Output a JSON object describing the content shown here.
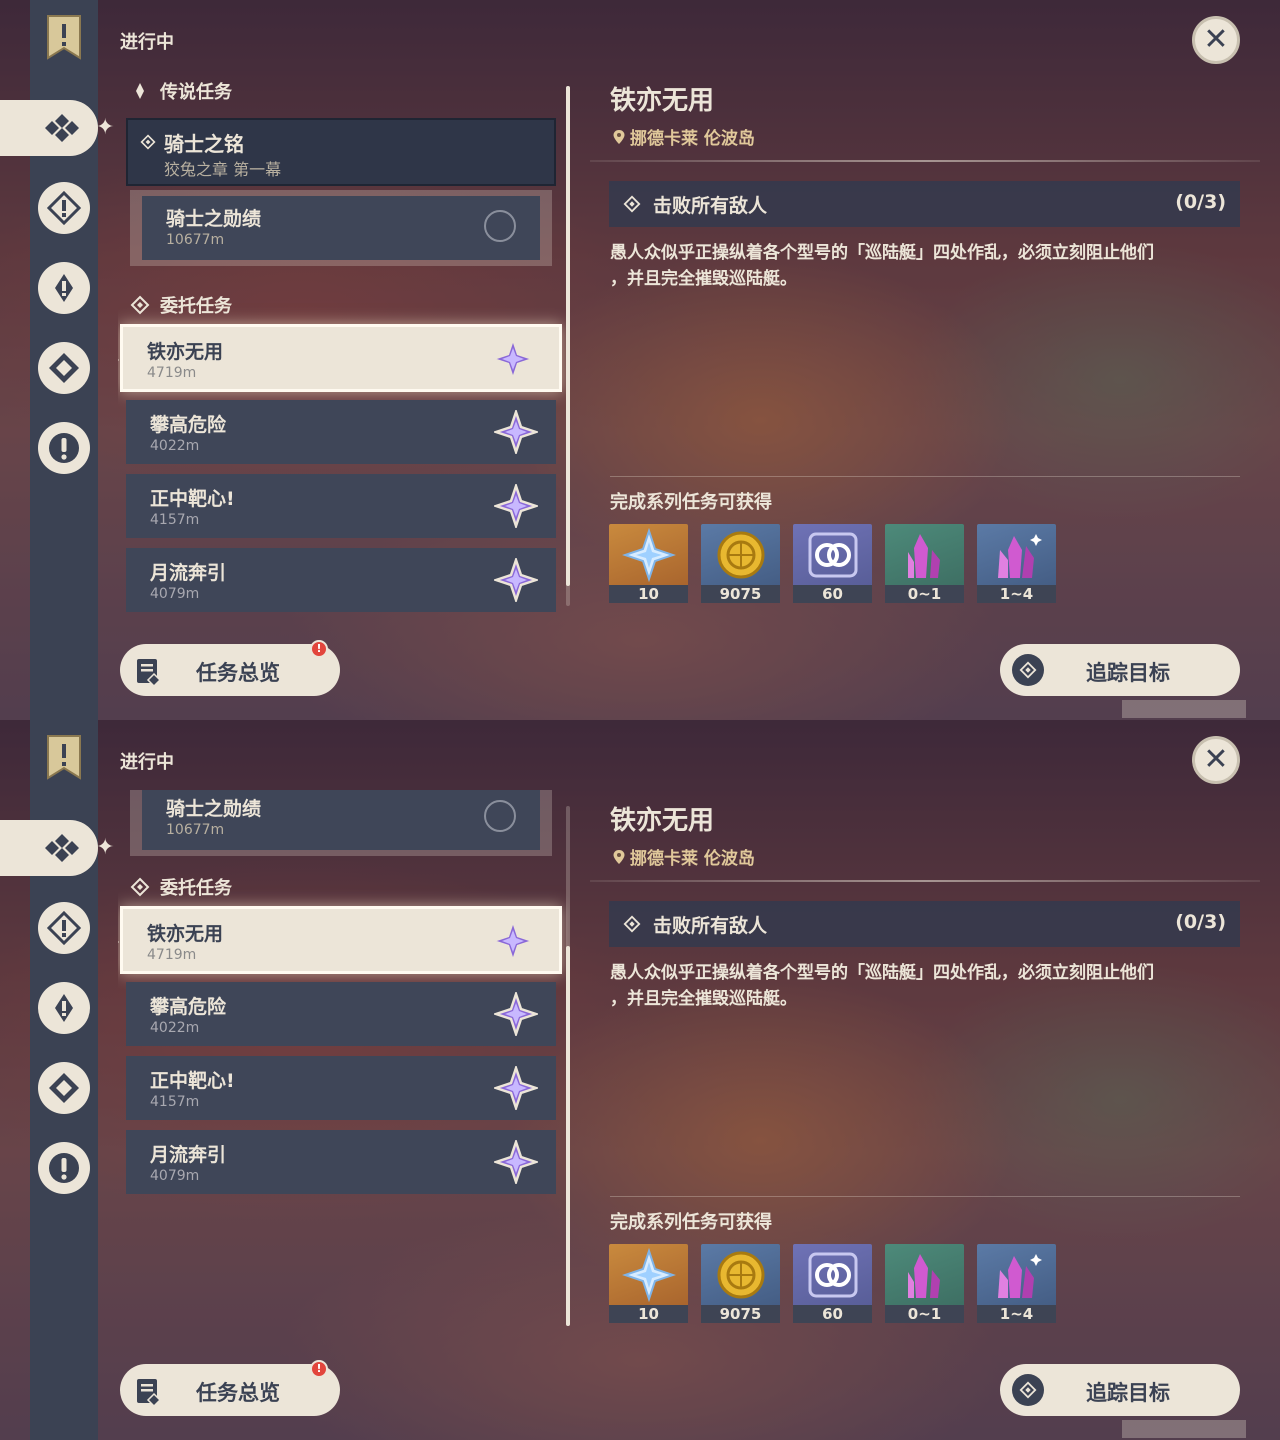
{
  "status_title": "进行中",
  "categories": {
    "archon": "传说任务",
    "commission": "委托任务"
  },
  "legend_quest": {
    "title": "骑士之铭",
    "chapter": "狡兔之章 第一幕",
    "step_title": "骑士之勋绩",
    "step_distance": "10677m"
  },
  "commissions": [
    {
      "title": "铁亦无用",
      "distance": "4719m"
    },
    {
      "title": "攀高危险",
      "distance": "4022m"
    },
    {
      "title": "正中靶心!",
      "distance": "4157m"
    },
    {
      "title": "月流奔引",
      "distance": "4079m"
    }
  ],
  "detail": {
    "title": "铁亦无用",
    "location": "挪德卡莱 伦波岛",
    "objective": "击败所有敌人",
    "objective_count": "(0/3)",
    "description_line1": "愚人众似乎正操纵着各个型号的「巡陆艇」四处作乱，必须立刻阻止他们",
    "description_line2": "，并且完全摧毁巡陆艇。",
    "rewards_title": "完成系列任务可获得",
    "rewards": [
      {
        "icon": "primogem-icon",
        "count": "10"
      },
      {
        "icon": "mora-icon",
        "count": "9075"
      },
      {
        "icon": "exp-icon",
        "count": "60"
      },
      {
        "icon": "crystal-icon",
        "count": "0~1"
      },
      {
        "icon": "crystal-cluster-icon",
        "count": "1~4"
      }
    ]
  },
  "buttons": {
    "overview": "任务总览",
    "overview_badge": "!",
    "track": "追踪目标"
  },
  "scroll": {
    "top_panel_position": 0.0,
    "bottom_panel_position": 1.0
  },
  "colors": {
    "panel_dark": "#3f4658",
    "cream": "#ece5d8",
    "location_gold": "#e0c89a",
    "badge_red": "#e2453c",
    "star_purple": "#8a68d8"
  }
}
